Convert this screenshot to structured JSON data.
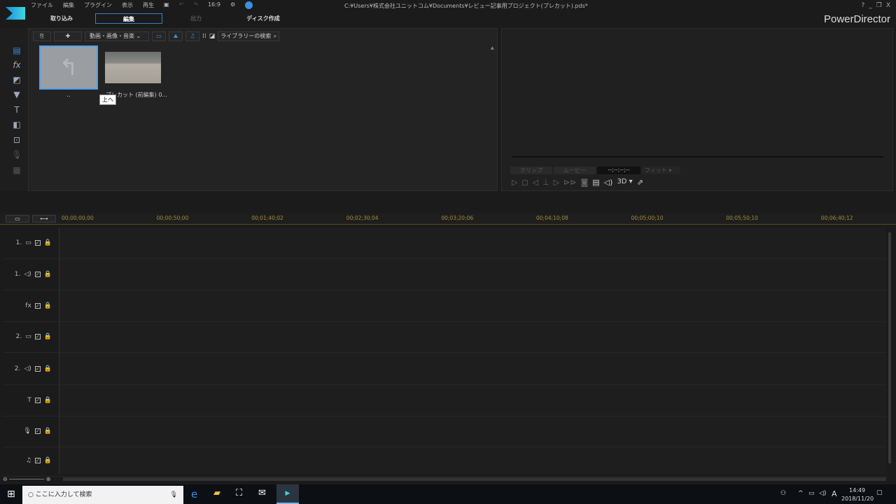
{
  "menu": [
    "ファイル",
    "編集",
    "プラグイン",
    "表示",
    "再生"
  ],
  "aspect": "16:9",
  "title": "C:¥Users¥株式会社ユニットコム¥Documents¥レビュー記事用プロジェクト(プレカット).pds*",
  "window_controls": {
    "help": "?",
    "min": "_",
    "restore": "❐",
    "close": "X"
  },
  "app_name": "PowerDirector",
  "tabs": [
    {
      "label": "取り込み"
    },
    {
      "label": "編集"
    },
    {
      "label": "出力"
    },
    {
      "label": "ディスク作成"
    }
  ],
  "library": {
    "filter": "動画・画像・音楽",
    "search_placeholder": "ライブラリーの検索",
    "items": [
      {
        "label": ".."
      },
      {
        "label": "プレカット (前編集) 0..."
      }
    ],
    "tooltip": "上へ"
  },
  "preview": {
    "clip": "クリップ",
    "movie": "ムービー",
    "timecode": "--;--;--;--",
    "fit": "フィット",
    "mode3d": "3D"
  },
  "ruler": [
    "00;00;00;00",
    "00;00;50;00",
    "00;01;40;02",
    "00;02;30;04",
    "00;03;20;06",
    "00;04;10;08",
    "00;05;00;10",
    "00;05;50;10",
    "00;06;40;12"
  ],
  "tracks": [
    {
      "num": "1.",
      "icon": "▭"
    },
    {
      "num": "1.",
      "icon": "◁)"
    },
    {
      "num": "",
      "icon": "fx"
    },
    {
      "num": "2.",
      "icon": "▭"
    },
    {
      "num": "2.",
      "icon": "◁)"
    },
    {
      "num": "",
      "icon": "T"
    },
    {
      "num": "",
      "icon": "🎙"
    },
    {
      "num": "",
      "icon": "♫"
    }
  ],
  "taskbar": {
    "search": "ここに入力して検索",
    "time": "14:49",
    "date": "2018/11/20",
    "ime": "A"
  }
}
